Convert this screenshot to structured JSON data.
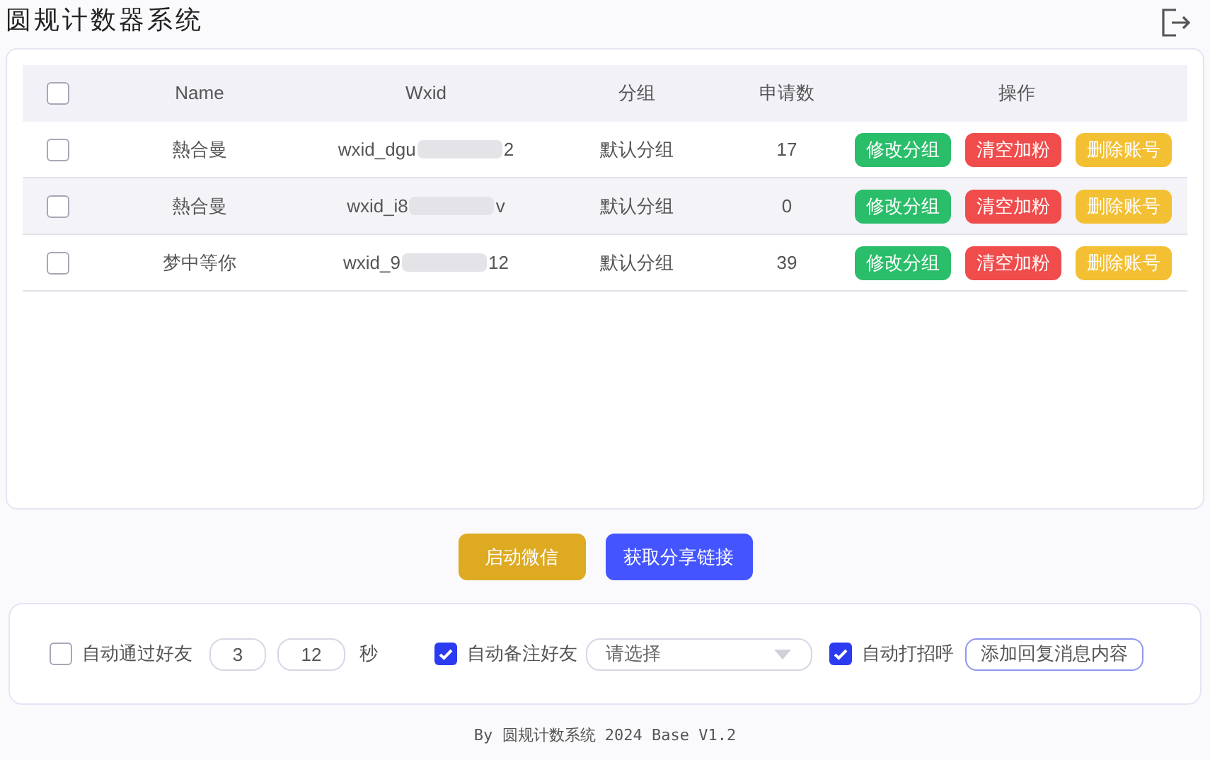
{
  "window": {
    "title": "圆规计数器系统"
  },
  "table": {
    "select_all": {
      "checked": false
    },
    "columns": [
      "Name",
      "Wxid",
      "分组",
      "申请数",
      "操作"
    ],
    "rows": [
      {
        "checked": false,
        "name": "熱合曼",
        "wxid_prefix": "wxid_dgu",
        "wxid_suffix": "2",
        "group": "默认分组",
        "count": "17",
        "actions": [
          {
            "label": "修改分组",
            "color": "#2abe6a"
          },
          {
            "label": "清空加粉",
            "color": "#f04c4c"
          },
          {
            "label": "删除账号",
            "color": "#f3bf33"
          }
        ]
      },
      {
        "checked": false,
        "name": "熱合曼",
        "wxid_prefix": "wxid_i8",
        "wxid_suffix": "v",
        "group": "默认分组",
        "count": "0",
        "actions": [
          {
            "label": "修改分组",
            "color": "#2abe6a"
          },
          {
            "label": "清空加粉",
            "color": "#f04c4c"
          },
          {
            "label": "删除账号",
            "color": "#f3bf33"
          }
        ]
      },
      {
        "checked": false,
        "name": "梦中等你",
        "wxid_prefix": "wxid_9",
        "wxid_suffix": "12",
        "group": "默认分组",
        "count": "39",
        "actions": [
          {
            "label": "修改分组",
            "color": "#2abe6a"
          },
          {
            "label": "清空加粉",
            "color": "#f04c4c"
          },
          {
            "label": "删除账号",
            "color": "#f3bf33"
          }
        ]
      }
    ]
  },
  "buttons": [
    {
      "label": "启动微信",
      "color": "#ddaa22"
    },
    {
      "label": "获取分享链接",
      "color": "#4455ff"
    }
  ],
  "settings": {
    "auto_accept": {
      "label": "自动通过好友",
      "checked": false,
      "min": "3",
      "max": "12",
      "unit": "秒"
    },
    "auto_remark": {
      "label": "自动备注好友",
      "checked": true,
      "placeholder": "请选择"
    },
    "auto_greet": {
      "label": "自动打招呼",
      "checked": true,
      "button": "添加回复消息内容"
    }
  },
  "footer": "By 圆规计数系统 2024 Base V1.2"
}
